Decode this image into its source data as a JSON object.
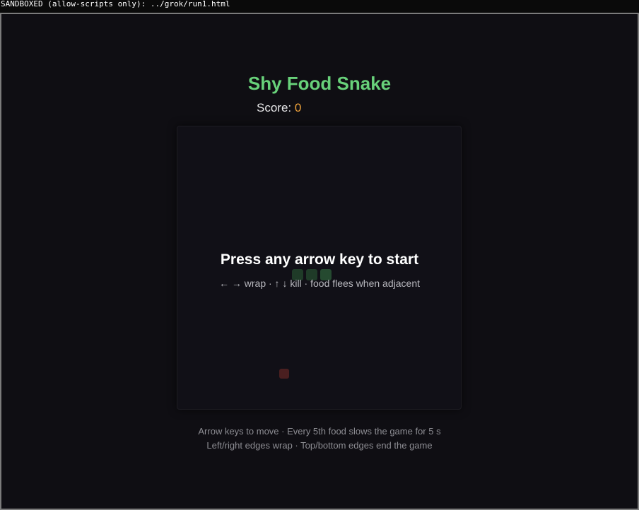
{
  "sandbox_bar": "SANDBOXED (allow-scripts only): ../grok/run1.html",
  "game": {
    "title": "Shy Food Snake",
    "score_label": "Score:",
    "score_value": "0",
    "overlay_title": "Press any arrow key to start",
    "overlay_hint": "← → wrap · ↑ ↓ kill · food flees when adjacent"
  },
  "instructions": {
    "line1": "Arrow keys to move · Every 5th food slows the game for 5 s",
    "line2": "Left/right edges wrap · Top/bottom edges end the game"
  },
  "colors": {
    "title": "#68d17a",
    "score_value": "#f2a43a",
    "snake": "#1f3b28",
    "food": "#4a1f20"
  }
}
